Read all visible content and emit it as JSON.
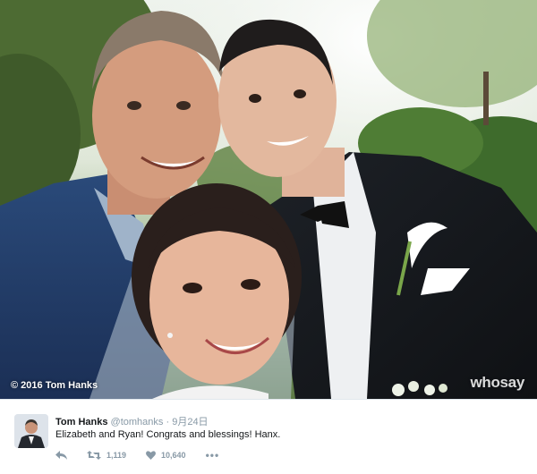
{
  "photo": {
    "alt": "",
    "copyright": "© 2016 Tom Hanks",
    "watermark": "whosay"
  },
  "tweet": {
    "avatar_icon": "profile-avatar-icon",
    "author_name": "Tom Hanks",
    "handle": "@tomhanks",
    "separator": "·",
    "date": "9月24日",
    "text": "Elizabeth and Ryan!  Congrats and blessings!  Hanx.",
    "actions": {
      "reply_icon": "reply-icon",
      "retweet_icon": "retweet-icon",
      "retweet_count": "1,119",
      "like_icon": "heart-icon",
      "like_count": "10,640",
      "more_icon": "more-icon",
      "more_label": "•••"
    }
  },
  "colors": {
    "text_primary": "#14171a",
    "text_secondary": "#8899a6",
    "divider": "#e1e8ed"
  }
}
